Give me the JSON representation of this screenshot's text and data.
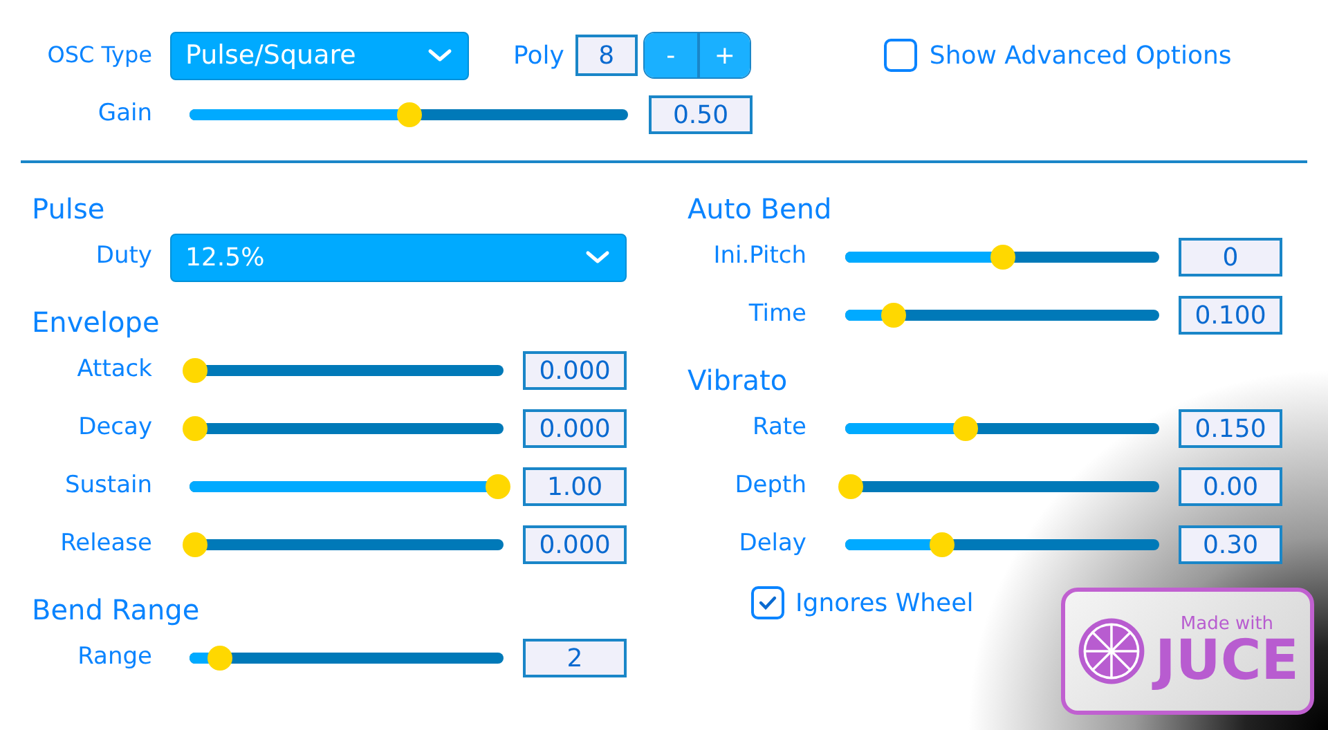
{
  "osc_type": {
    "label": "OSC Type",
    "value": "Pulse/Square"
  },
  "poly": {
    "label": "Poly",
    "value": "8",
    "buttons": [
      "-",
      "+"
    ]
  },
  "show_advanced": {
    "label": "Show Advanced Options",
    "checked": false
  },
  "gain": {
    "label": "Gain",
    "level": 0.5,
    "reading": "0.50"
  },
  "left_column": [
    {
      "title": "Pulse",
      "rows": [
        {
          "kind": "dropdown",
          "label": "Duty",
          "value": "12.5%"
        }
      ]
    },
    {
      "title": "Envelope",
      "rows": [
        {
          "kind": "slider",
          "label": "Attack",
          "level": 0,
          "reading": "0.000"
        },
        {
          "kind": "slider",
          "label": "Decay",
          "level": 0,
          "reading": "0.000"
        },
        {
          "kind": "slider",
          "label": "Sustain",
          "level": 1,
          "reading": "1.00"
        },
        {
          "kind": "slider",
          "label": "Release",
          "level": 0,
          "reading": "0.000"
        }
      ]
    },
    {
      "title": "Bend Range",
      "rows": [
        {
          "kind": "slider",
          "label": "Range",
          "level": 0.08,
          "reading": "2"
        }
      ]
    }
  ],
  "right_column": [
    {
      "title": "Auto Bend",
      "rows": [
        {
          "kind": "slider",
          "label": "Ini.Pitch",
          "level": 0.5,
          "reading": "0"
        },
        {
          "kind": "slider",
          "label": "Time",
          "level": 0.14,
          "reading": "0.100"
        }
      ]
    },
    {
      "title": "Vibrato",
      "rows": [
        {
          "kind": "slider",
          "label": "Rate",
          "level": 0.38,
          "reading": "0.150"
        },
        {
          "kind": "slider",
          "label": "Depth",
          "level": 0,
          "reading": "0.00"
        },
        {
          "kind": "slider",
          "label": "Delay",
          "level": 0.3,
          "reading": "0.30"
        },
        {
          "kind": "checkbox",
          "label": "Ignores Wheel",
          "checked": true
        }
      ]
    }
  ],
  "badge": {
    "line1": "Made with",
    "line2": "JUCE"
  }
}
